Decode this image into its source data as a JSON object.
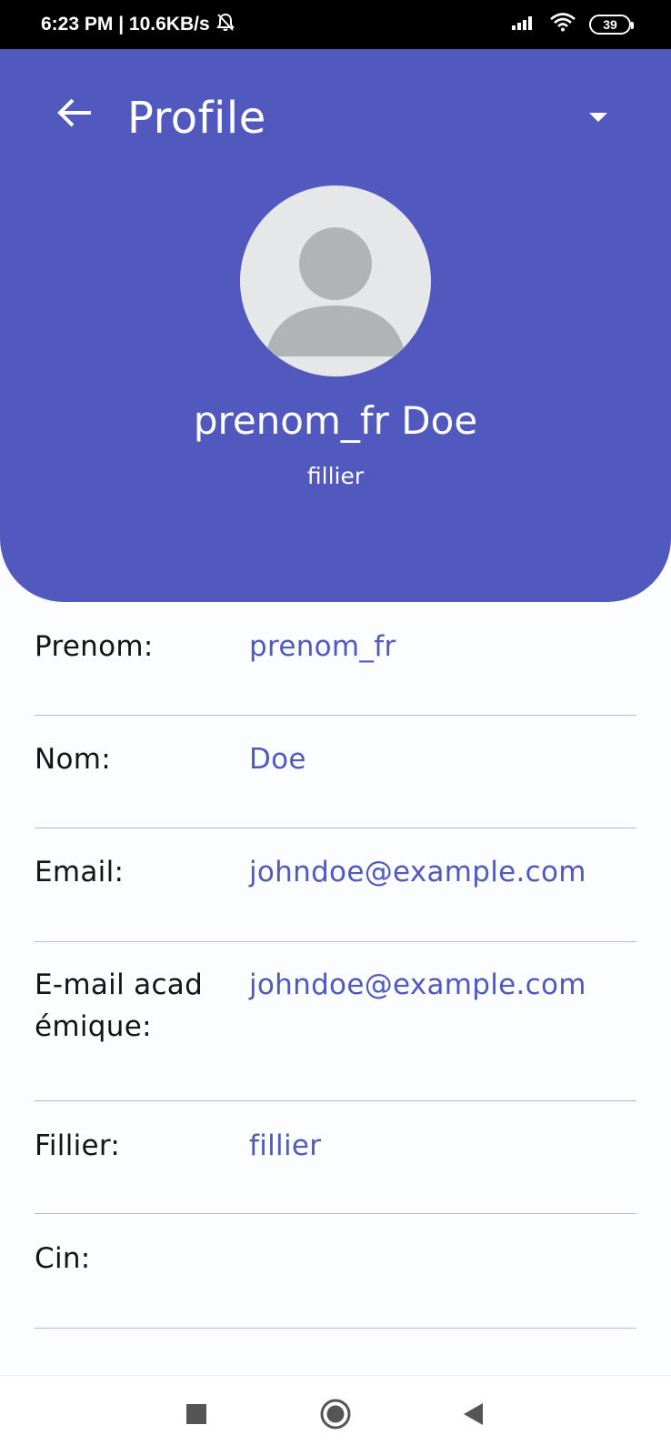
{
  "status_bar": {
    "time_speed": "6:23 PM | 10.6KB/s",
    "battery": "39",
    "icons": [
      "mute-bell-icon",
      "signal-icon",
      "wifi-icon",
      "battery-icon"
    ]
  },
  "header": {
    "title": "Profile",
    "back_icon": "arrow-left-icon",
    "menu_icon": "caret-down-icon",
    "background_color": "#5158be"
  },
  "profile": {
    "name": "prenom_fr Doe",
    "subtitle": "fillier",
    "avatar_icon": "person-placeholder-icon"
  },
  "fields": [
    {
      "label": "Prenom:",
      "value": "prenom_fr"
    },
    {
      "label": "Nom:",
      "value": "Doe"
    },
    {
      "label": "Email:",
      "value": "johndoe@example.com"
    },
    {
      "label": "E-mail acad émique:",
      "label_line1": "E-mail acad",
      "label_line2": "émique:",
      "value": "johndoe@example.com"
    },
    {
      "label": "Fillier:",
      "value": "fillier"
    },
    {
      "label": "Cin:",
      "value": ""
    }
  ],
  "nav_bar": {
    "buttons": [
      "recents-square-icon",
      "home-circle-icon",
      "back-triangle-icon"
    ]
  },
  "colors": {
    "accent": "#5158be",
    "label_text": "#141414",
    "divider": "#b4b8dc"
  }
}
